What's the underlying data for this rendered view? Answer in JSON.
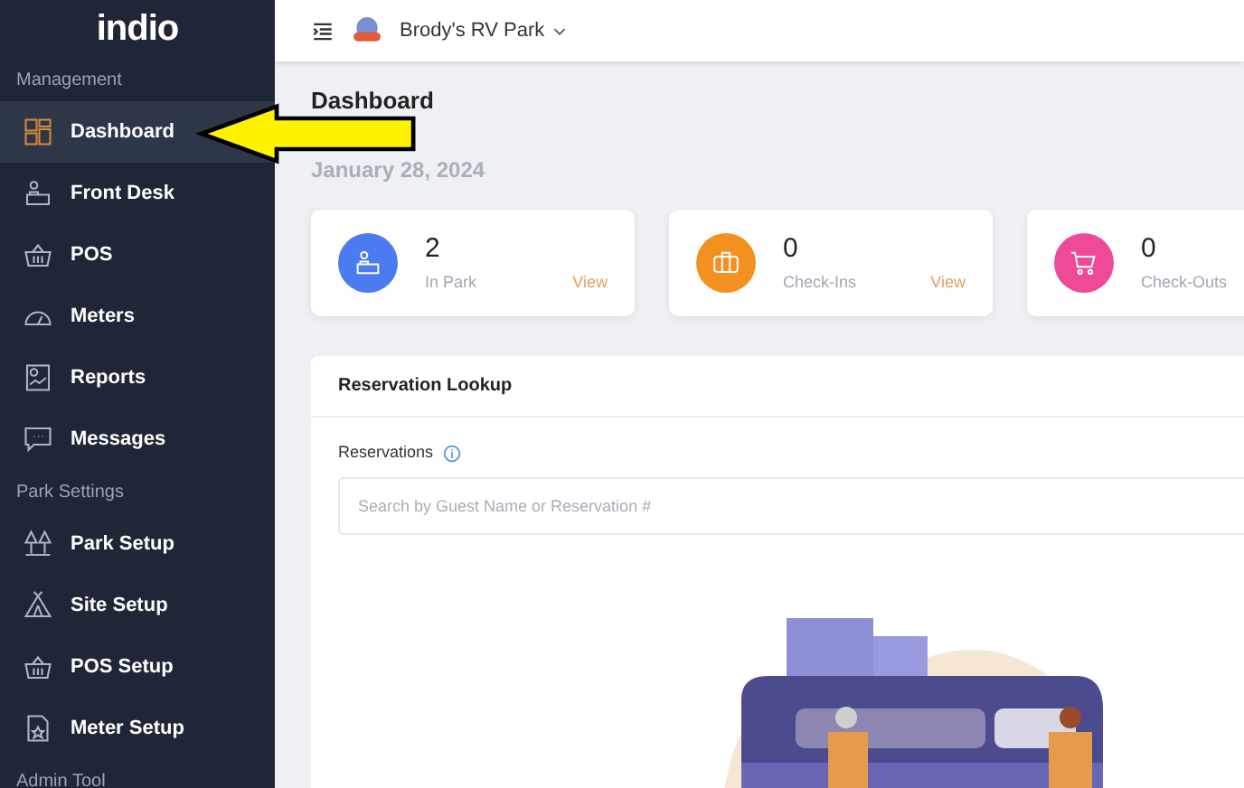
{
  "sidebar": {
    "logo": "indio",
    "sections": [
      {
        "title": "Management",
        "items": [
          {
            "label": "Dashboard",
            "kind": "grid",
            "selected": true
          },
          {
            "label": "Front Desk",
            "kind": "desk",
            "selected": false
          },
          {
            "label": "POS",
            "kind": "basket",
            "selected": false
          },
          {
            "label": "Meters",
            "kind": "gauge",
            "selected": false
          },
          {
            "label": "Reports",
            "kind": "report",
            "selected": false
          },
          {
            "label": "Messages",
            "kind": "message",
            "selected": false
          }
        ]
      },
      {
        "title": "Park Settings",
        "items": [
          {
            "label": "Park Setup",
            "kind": "trees",
            "selected": false
          },
          {
            "label": "Site Setup",
            "kind": "tent",
            "selected": false
          },
          {
            "label": "POS Setup",
            "kind": "basket",
            "selected": false
          },
          {
            "label": "Meter Setup",
            "kind": "file",
            "selected": false
          }
        ]
      },
      {
        "title": "Admin Tool"
      }
    ]
  },
  "topbar": {
    "park_name": "Brody's RV Park"
  },
  "page": {
    "title": "Dashboard",
    "date": "January 28, 2024"
  },
  "stats": [
    {
      "value": "2",
      "label": "In Park",
      "link": "View",
      "kind": "desk",
      "color": "#4a7cf0"
    },
    {
      "value": "0",
      "label": "Check-Ins",
      "link": "View",
      "kind": "suitcase",
      "color": "#f29020"
    },
    {
      "value": "0",
      "label": "Check-Outs",
      "kind": "cart",
      "color": "#ee4a97"
    }
  ],
  "reservation_lookup": {
    "title": "Reservation Lookup",
    "field_label": "Reservations",
    "placeholder": "Search by Guest Name or Reservation #"
  }
}
